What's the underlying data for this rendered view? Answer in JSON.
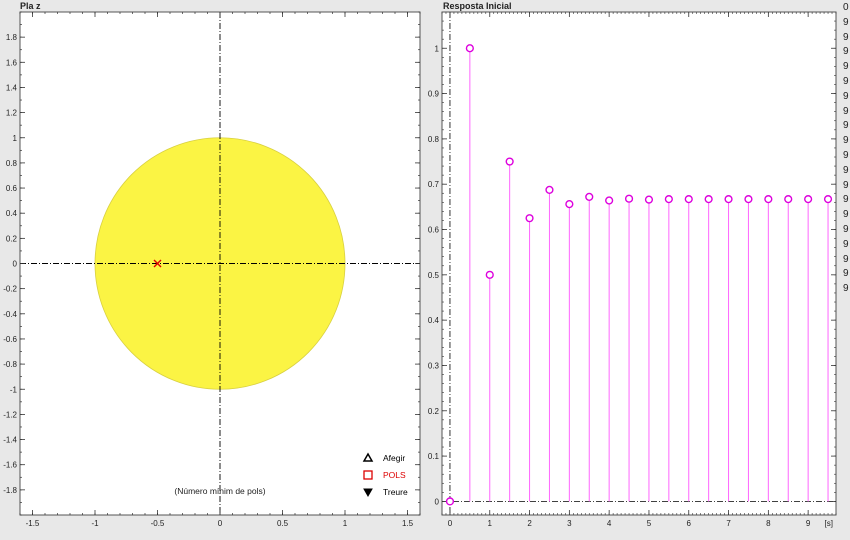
{
  "left_panel": {
    "title": "Pla z",
    "note": "(Número mínim de pols)",
    "legend": [
      {
        "symbol": "triangle-up",
        "label": "Afegir",
        "color": "#000000"
      },
      {
        "symbol": "square",
        "label": "POLS",
        "color": "#dd0000"
      },
      {
        "symbol": "triangle-down",
        "label": "Treure",
        "color": "#000000"
      }
    ]
  },
  "right_panel": {
    "title": "Resposta Inicial",
    "unit_label": "[s]"
  },
  "side_strip": [
    "0",
    "9",
    "9",
    "9",
    "9",
    "9",
    "9",
    "9",
    "9",
    "9",
    "9",
    "9",
    "9",
    "9",
    "9",
    "9",
    "9",
    "9",
    "9",
    "9"
  ],
  "colors": {
    "unit_circle_fill": "#fbf444",
    "pole": "#dd0000",
    "stem": "#ff66ff",
    "marker": "#dd00dd",
    "axis_dashdot": "#000000"
  },
  "chart_data": [
    {
      "type": "scatter",
      "title": "Pla z",
      "xlim": [
        -1.6,
        1.6
      ],
      "ylim": [
        -2.0,
        2.0
      ],
      "xticks": [
        -1.5,
        -1,
        -0.5,
        0,
        0.5,
        1,
        1.5
      ],
      "xtick_labels": [
        "-1.5",
        "-1",
        "-0.5",
        "0",
        "0.5",
        "1",
        "1.5"
      ],
      "yticks": [
        1.8,
        1.6,
        1.4,
        1.2,
        1,
        0.8,
        0.6,
        0.4,
        0.2,
        0,
        -0.2,
        -0.4,
        -0.6,
        -0.8,
        -1,
        -1.2,
        -1.4,
        -1.6,
        -1.8
      ],
      "ytick_labels": [
        "1.8",
        "1.6",
        "1.4",
        "1.2",
        "1",
        "0.8",
        "0.6",
        "0.4",
        "0.2",
        "0",
        "-0.2",
        "-0.4",
        "-0.6",
        "-0.8",
        "-1",
        "-1.2",
        "-1.4",
        "-1.6",
        "-1.8"
      ],
      "unit_circle_radius": 1,
      "poles": [
        {
          "x": -0.5,
          "y": 0
        }
      ]
    },
    {
      "type": "stem",
      "title": "Resposta Inicial",
      "xlim": [
        -0.2,
        9.7
      ],
      "ylim": [
        -0.03,
        1.08
      ],
      "xticks": [
        0,
        1,
        2,
        3,
        4,
        5,
        6,
        7,
        8,
        9
      ],
      "xtick_labels": [
        "0",
        "1",
        "2",
        "3",
        "4",
        "5",
        "6",
        "7",
        "8",
        "9"
      ],
      "yticks": [
        0,
        0.1,
        0.2,
        0.3,
        0.4,
        0.5,
        0.6,
        0.7,
        0.8,
        0.9,
        1
      ],
      "ytick_labels": [
        "0",
        "0.1",
        "0.2",
        "0.3",
        "0.4",
        "0.5",
        "0.6",
        "0.7",
        "0.8",
        "0.9",
        "1"
      ],
      "x": [
        0,
        0.5,
        1,
        1.5,
        2,
        2.5,
        3,
        3.5,
        4,
        4.5,
        5,
        5.5,
        6,
        6.5,
        7,
        7.5,
        8,
        8.5,
        9,
        9.5
      ],
      "values": [
        0,
        1,
        0.5,
        0.75,
        0.625,
        0.6875,
        0.656,
        0.672,
        0.664,
        0.668,
        0.666,
        0.667,
        0.667,
        0.667,
        0.667,
        0.667,
        0.667,
        0.667,
        0.667,
        0.667
      ]
    }
  ]
}
